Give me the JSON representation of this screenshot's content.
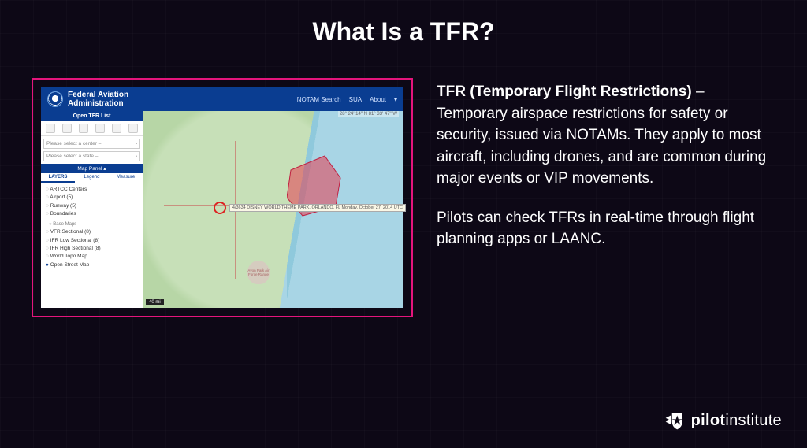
{
  "title": "What Is a TFR?",
  "text": {
    "term": "TFR (Temporary Flight Restrictions)",
    "dash": " – ",
    "body1_rest": "Temporary airspace restrictions for safety or security, issued via NOTAMs. They apply to most aircraft, including drones, and are common during major events or VIP movements.",
    "body2": "Pilots can check TFRs in real-time through flight planning apps or LAANC."
  },
  "faa": {
    "org": "Federal Aviation\nAdministration",
    "nav": {
      "search": "NOTAM Search",
      "sua": "SUA",
      "about": "About"
    },
    "sidebar": {
      "open_tfr": "Open TFR List",
      "select_center": "Please select a center –",
      "select_state": "Please select a state –",
      "map_panel": "Map Panel ▴",
      "tabs": {
        "layers": "LAYERS",
        "legend": "Legend",
        "measure": "Measure"
      },
      "layers_top": [
        "ARTCC Centers",
        "Airport (5)",
        "Runway (5)",
        "Boundaries"
      ],
      "section": "Base Maps",
      "layers_bottom": [
        "VFR Sectional (8)",
        "IFR Low Sectional (8)",
        "IFR High Sectional (8)",
        "World Topo Map",
        "Open Street Map"
      ]
    },
    "map": {
      "coords": "28° 24' 14\" N  81° 33' 47\" W",
      "label": "4/3634 DISNEY WORLD THEME PARK, ORLANDO, FL Monday, October 27, 2014 UTC",
      "blob": "Avon Park Air Force Range",
      "scale": "40 mi"
    }
  },
  "brand": {
    "bold": "pilot",
    "rest": "institute"
  }
}
